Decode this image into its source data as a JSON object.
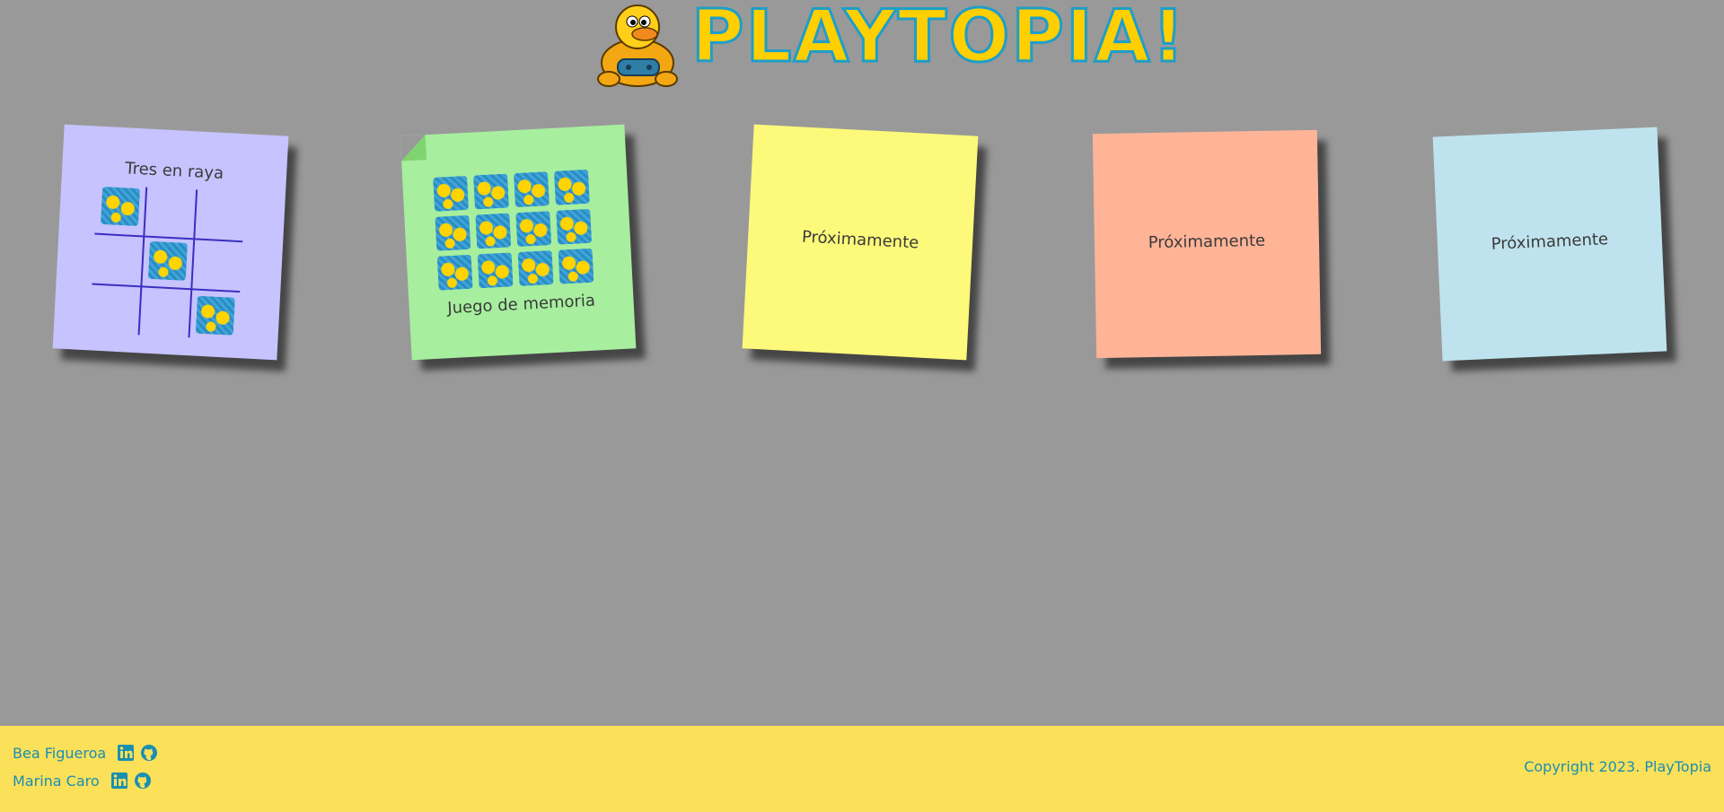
{
  "header": {
    "logo_text": "PLAYTOPIA!"
  },
  "notes": [
    {
      "label": "Tres en raya"
    },
    {
      "label": "Juego de memoria"
    },
    {
      "label": "Próximamente"
    },
    {
      "label": "Próximamente"
    },
    {
      "label": "Próximamente"
    }
  ],
  "footer": {
    "authors": [
      {
        "name": "Bea Figueroa",
        "icons": [
          "linkedin-icon",
          "github-icon"
        ]
      },
      {
        "name": "Marina Caro",
        "icons": [
          "linkedin-icon",
          "github-icon"
        ]
      }
    ],
    "copyright": "Copyright 2023. PlayTopia"
  },
  "colors": {
    "background": "#999999",
    "footer": "#fbe05a",
    "link": "#1a8fb0",
    "note_purple": "#c6c3ff",
    "note_green": "#a7ee9f",
    "note_yellow": "#fdf97b",
    "note_orange": "#ffb497",
    "note_blue": "#bfe3ee"
  }
}
